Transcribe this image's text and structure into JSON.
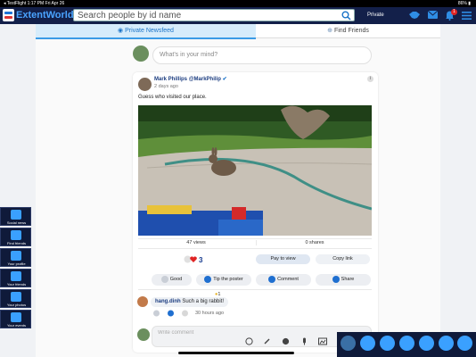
{
  "statusbar": {
    "left": "◂ TestFlight  1:17 PM  Fri Apr 26",
    "right": "86% ▮"
  },
  "app": {
    "brand": "ExtentWorld",
    "brand_color": "#4aa3ff",
    "nav_bg": "#13204a",
    "accent": "#3aa0ff"
  },
  "search": {
    "placeholder": "Search people by id name"
  },
  "header": {
    "privacy": "Private",
    "notification_count": "1"
  },
  "tabs": [
    {
      "label": "Private Newsfeed",
      "active": true
    },
    {
      "label": "Find Friends",
      "active": false
    }
  ],
  "composer": {
    "placeholder": "What's in your mind?"
  },
  "post": {
    "author": "Mark Phillips",
    "handle": "@MarkPhilip",
    "time": "2 days ago",
    "text": "Guess who visited our place.",
    "views": "47 views",
    "shares": "0 shares",
    "reaction_count": "3",
    "pay_to_view": "Pay to view",
    "copy_link": "Copy link",
    "actions": [
      {
        "label": "Good",
        "icon": "thumb-icon"
      },
      {
        "label": "Tip the poster",
        "icon": "tip-icon"
      },
      {
        "label": "Comment",
        "icon": "comment-icon"
      },
      {
        "label": "Share",
        "icon": "share-icon"
      }
    ]
  },
  "comment": {
    "user": "hang.dinh",
    "text": "Such a big rabbit!",
    "time": "30 hours ago",
    "reaction": "1"
  },
  "reply": {
    "placeholder": "Write comment"
  },
  "left_dock": [
    {
      "label": "Social news",
      "icon": "rss-icon"
    },
    {
      "label": "Find friends",
      "icon": "find-friends-icon"
    },
    {
      "label": "Your profile",
      "icon": "profile-icon"
    },
    {
      "label": "Your friends",
      "icon": "friends-icon"
    },
    {
      "label": "Your photos",
      "icon": "photos-icon"
    },
    {
      "label": "Your events",
      "icon": "events-icon"
    }
  ],
  "right_dock": [
    "menu-icon",
    "user-icon",
    "user-plus-icon",
    "chat-icon",
    "video-icon",
    "group-icon",
    "bookmark-icon"
  ]
}
